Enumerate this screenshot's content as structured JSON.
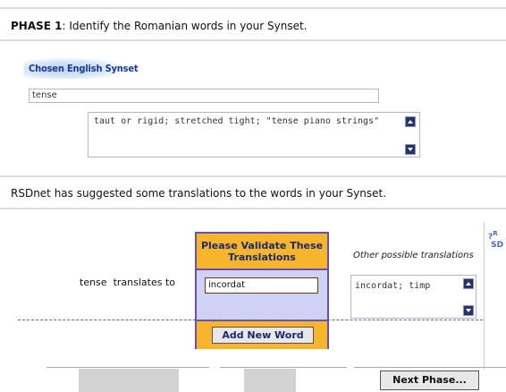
{
  "phase": {
    "label": "PHASE 1",
    "instruction": ": Identify the Romanian words in your Synset."
  },
  "synset": {
    "logo_text": "Chosen English Synset",
    "word": "tense",
    "gloss": "taut or rigid; stretched tight; \"tense piano strings\""
  },
  "suggestion_text": "RSDnet has suggested some translations to the words in your Synset.",
  "translation": {
    "source_word": "tense",
    "translates_to_label": "translates to",
    "validate_header": "Please Validate These Translations",
    "validated_word": "incordat",
    "add_button_label": "Add New Word",
    "other_label": "Other possible translations",
    "other_values": "incordat; timp"
  },
  "help_icon": {
    "name": "help-rsd-icon",
    "glyph": "?R SD"
  },
  "next_button_label": "Next Phase...",
  "colors": {
    "accent_orange": "#f7b52e",
    "panel_lavender": "#cfd2f4",
    "panel_border": "#6a4fae",
    "scroll_button": "#24346a"
  }
}
